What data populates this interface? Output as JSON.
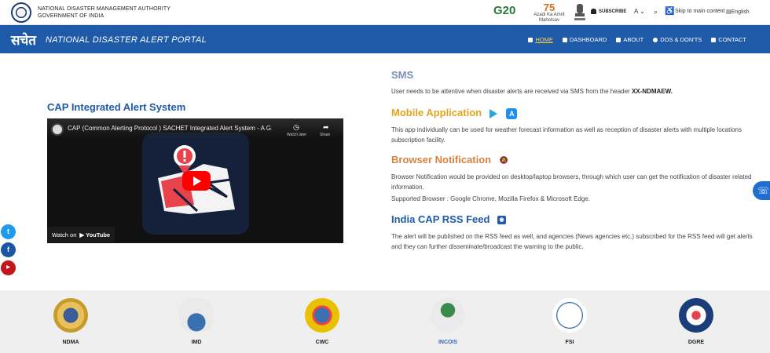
{
  "topbar": {
    "org_line1": "NATIONAL DISASTER MANAGEMENT AUTHORITY",
    "org_line2": "GOVERNMENT OF INDIA",
    "g20": "G20",
    "azadi_big": "75",
    "azadi_small": "Azadi Ka Amrit Mahotsav",
    "subscribe": "SUBSCRIBE",
    "font_size": "A",
    "skip": "Skip to main content",
    "language": "English"
  },
  "navbar": {
    "logo_hindi": "सचेत",
    "logo_text": "NATIONAL DISASTER ALERT PORTAL",
    "items": [
      {
        "label": "HOME",
        "active": true
      },
      {
        "label": "DASHBOARD"
      },
      {
        "label": "ABOUT"
      },
      {
        "label": "DOS & DON'TS"
      },
      {
        "label": "CONTACT"
      }
    ]
  },
  "video": {
    "heading": "CAP Integrated Alert System",
    "title": "CAP (Common Alerting Protocol ) SACHET Integrated Alert System - A G...",
    "watch_later": "Watch later",
    "share": "Share",
    "watch_on": "Watch on",
    "youtube": "YouTube"
  },
  "sections": {
    "sms": {
      "heading": "SMS",
      "text": "User needs to be attentive when disaster alerts are received via SMS from the header ",
      "header_code": "XX-NDMAEW."
    },
    "mobile": {
      "heading": "Mobile Application",
      "text": "This app individually can be used for weather forecast information as well as reception of disaster alerts with multiple locations subscription facility."
    },
    "browser": {
      "heading": "Browser Notification",
      "text": "Browser Notification would be provided on desktop/laptop browsers, through which user can get the notification of disaster related information.",
      "supported": "Supported Browser : Google Chrome, Mozilla Firefox & Microsoft Edge."
    },
    "rss": {
      "heading": "India CAP RSS Feed",
      "text": "The alert will be published on the RSS feed as well, and agencies (News agencies etc.) subscribed for the RSS feed will get alerts and they can further disseminate/broadcast the warning to the public."
    }
  },
  "partners": [
    {
      "name": "NDMA",
      "color": "#c79a2c"
    },
    {
      "name": "IMD",
      "color": "#3a6fb0"
    },
    {
      "name": "CWC",
      "color": "#e9c100"
    },
    {
      "name": "INCOIS",
      "color": "#2c6cb5"
    },
    {
      "name": "FSI",
      "color": "#3a8a4a"
    },
    {
      "name": "DGRE",
      "color": "#1b3d7a"
    }
  ],
  "colors": {
    "nav_bg": "#1e5aa8",
    "accent_yellow": "#ffd54a"
  }
}
